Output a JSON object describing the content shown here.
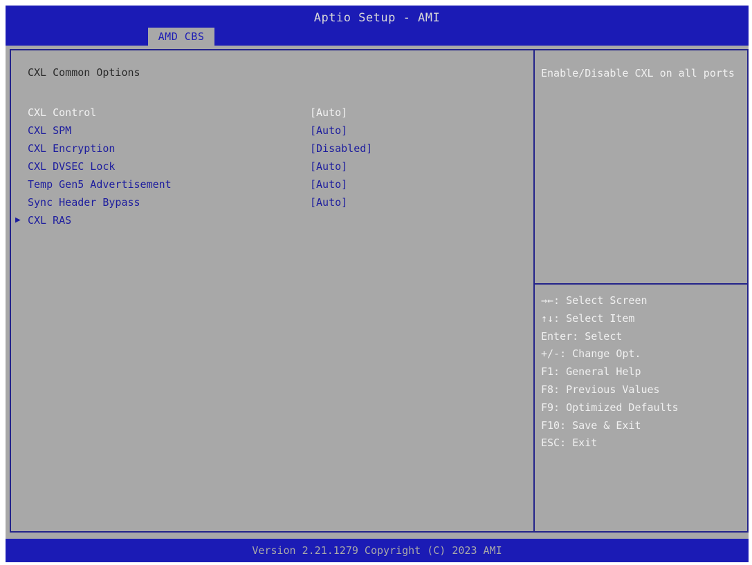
{
  "header": {
    "title": "Aptio Setup - AMI",
    "tab": "AMD CBS"
  },
  "main": {
    "section_title": "CXL Common Options",
    "items": [
      {
        "label": "CXL Control",
        "value": "[Auto]",
        "selected": true
      },
      {
        "label": "CXL SPM",
        "value": "[Auto]"
      },
      {
        "label": "CXL Encryption",
        "value": "[Disabled]"
      },
      {
        "label": "CXL DVSEC Lock",
        "value": "[Auto]"
      },
      {
        "label": "Temp Gen5 Advertisement",
        "value": "[Auto]"
      },
      {
        "label": "Sync Header Bypass",
        "value": "[Auto]"
      },
      {
        "label": "CXL RAS",
        "submenu": true,
        "arrow": "▶"
      }
    ]
  },
  "help": {
    "text": "Enable/Disable CXL on all ports",
    "keys": [
      "→←: Select Screen",
      "↑↓: Select Item",
      "Enter: Select",
      "+/-: Change Opt.",
      "F1: General Help",
      "F8: Previous Values",
      "F9: Optimized Defaults",
      "F10: Save & Exit",
      "ESC: Exit"
    ]
  },
  "footer": {
    "version": "Version 2.21.1279 Copyright (C) 2023 AMI"
  }
}
